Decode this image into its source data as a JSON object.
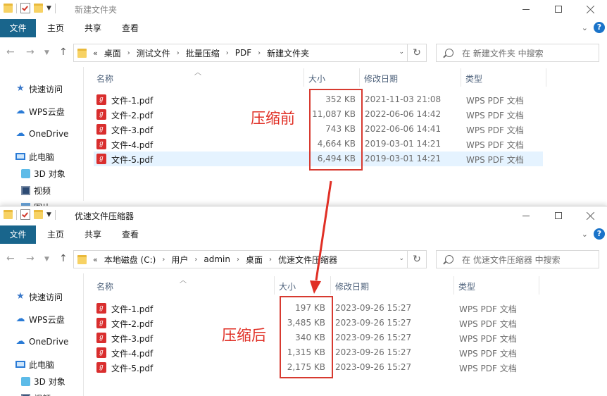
{
  "top_window": {
    "title": "新建文件夹",
    "ribbon": {
      "file": "文件",
      "home": "主页",
      "share": "共享",
      "view": "查看"
    },
    "breadcrumb": [
      "桌面",
      "测试文件",
      "批量压缩",
      "PDF",
      "新建文件夹"
    ],
    "breadcrumb_prefix": "«",
    "search_placeholder": "在 新建文件夹 中搜索",
    "sidebar": [
      "快速访问",
      "WPS云盘",
      "OneDrive",
      "此电脑",
      "3D 对象",
      "视频",
      "图片"
    ],
    "columns": {
      "name": "名称",
      "size": "大小",
      "modified": "修改日期",
      "type": "类型"
    },
    "files": [
      {
        "name": "文件-1.pdf",
        "size": "352 KB",
        "modified": "2021-11-03 21:08",
        "type": "WPS PDF 文档"
      },
      {
        "name": "文件-2.pdf",
        "size": "11,087 KB",
        "modified": "2022-06-06 14:42",
        "type": "WPS PDF 文档"
      },
      {
        "name": "文件-3.pdf",
        "size": "743 KB",
        "modified": "2022-06-06 14:41",
        "type": "WPS PDF 文档"
      },
      {
        "name": "文件-4.pdf",
        "size": "4,664 KB",
        "modified": "2019-03-01 14:21",
        "type": "WPS PDF 文档"
      },
      {
        "name": "文件-5.pdf",
        "size": "6,494 KB",
        "modified": "2019-03-01 14:21",
        "type": "WPS PDF 文档"
      }
    ],
    "annotation": "压缩前"
  },
  "bottom_window": {
    "title": "优速文件压缩器",
    "ribbon": {
      "file": "文件",
      "home": "主页",
      "share": "共享",
      "view": "查看"
    },
    "breadcrumb": [
      "本地磁盘 (C:)",
      "用户",
      "admin",
      "桌面",
      "优速文件压缩器"
    ],
    "breadcrumb_prefix": "«",
    "search_placeholder": "在 优速文件压缩器 中搜索",
    "sidebar": [
      "快速访问",
      "WPS云盘",
      "OneDrive",
      "此电脑",
      "3D 对象",
      "视频"
    ],
    "columns": {
      "name": "名称",
      "size": "大小",
      "modified": "修改日期",
      "type": "类型"
    },
    "files": [
      {
        "name": "文件-1.pdf",
        "size": "197 KB",
        "modified": "2023-09-26 15:27",
        "type": "WPS PDF 文档"
      },
      {
        "name": "文件-2.pdf",
        "size": "3,485 KB",
        "modified": "2023-09-26 15:27",
        "type": "WPS PDF 文档"
      },
      {
        "name": "文件-3.pdf",
        "size": "340 KB",
        "modified": "2023-09-26 15:27",
        "type": "WPS PDF 文档"
      },
      {
        "name": "文件-4.pdf",
        "size": "1,315 KB",
        "modified": "2023-09-26 15:27",
        "type": "WPS PDF 文档"
      },
      {
        "name": "文件-5.pdf",
        "size": "2,175 KB",
        "modified": "2023-09-26 15:27",
        "type": "WPS PDF 文档"
      }
    ],
    "annotation": "压缩后"
  },
  "colors": {
    "accent": "#19658c",
    "annotation_red": "#e02f25",
    "selection": "#e5f3ff"
  },
  "icons": [
    "folder-icon",
    "properties-check-icon",
    "minimize-icon",
    "maximize-icon",
    "close-icon",
    "help-icon",
    "back-arrow-icon",
    "forward-arrow-icon",
    "up-arrow-icon",
    "refresh-icon",
    "search-icon",
    "pdf-file-icon",
    "star-icon",
    "cloud-icon",
    "computer-icon",
    "3d-objects-icon",
    "video-icon",
    "pictures-icon"
  ]
}
